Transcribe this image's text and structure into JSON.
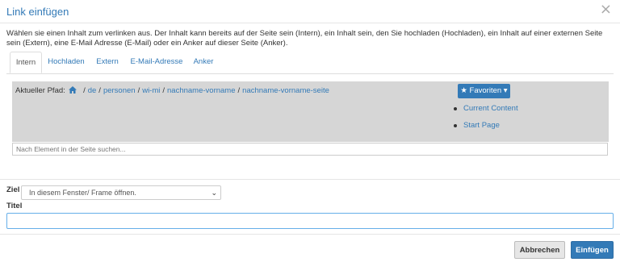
{
  "dialog": {
    "title": "Link einfügen",
    "close_glyph": "×",
    "intro": "Wählen sie einen Inhalt zum verlinken aus. Der Inhalt kann bereits auf der Seite sein (Intern), ein Inhalt sein, den Sie hochladen (Hochladen), ein Inhalt auf einer externen Seite sein (Extern), eine E-Mail Adresse (E-Mail) oder ein Anker auf dieser Seite (Anker)."
  },
  "tabs": [
    {
      "label": "Intern",
      "active": true
    },
    {
      "label": "Hochladen",
      "active": false
    },
    {
      "label": "Extern",
      "active": false
    },
    {
      "label": "E-Mail-Adresse",
      "active": false
    },
    {
      "label": "Anker",
      "active": false
    }
  ],
  "path": {
    "label": "Aktueller Pfad:",
    "home_icon": "home-icon",
    "separator": "/",
    "segments": [
      "de",
      "personen",
      "wi-mi",
      "nachname-vorname",
      "nachname-vorname-seite"
    ]
  },
  "favorites": {
    "button_label": "★ Favoriten ▾",
    "items": [
      "Current Content",
      "Start Page"
    ]
  },
  "search": {
    "placeholder": "Nach Element in der Seite suchen..."
  },
  "target": {
    "label": "Ziel",
    "selected": "In diesem Fenster/ Frame öffnen.",
    "chevron": "⌄"
  },
  "title_field": {
    "label": "Titel",
    "value": ""
  },
  "footer": {
    "cancel_label": "Abbrechen",
    "ok_label": "Einfügen"
  },
  "colors": {
    "accent": "#337ab7",
    "panel_bg": "#d6d6d6"
  }
}
